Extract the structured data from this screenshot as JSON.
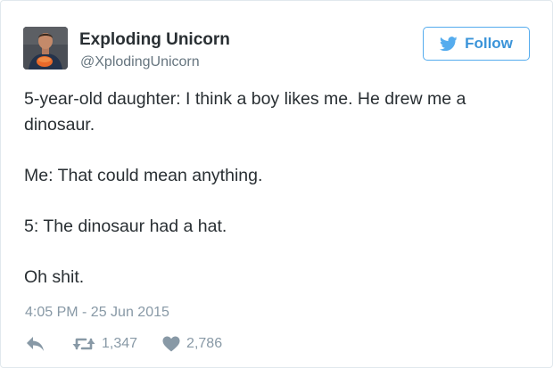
{
  "tweet": {
    "author": {
      "display_name": "Exploding Unicorn",
      "screen_name": "@XplodingUnicorn"
    },
    "follow_label": "Follow",
    "text_paragraphs": [
      "5-year-old daughter: I think a boy likes me. He drew me a dinosaur.",
      "Me: That could mean anything.",
      "5: The dinosaur had a hat.",
      "Oh shit."
    ],
    "timestamp": "4:05 PM - 25 Jun 2015",
    "retweet_count": "1,347",
    "like_count": "2,786"
  },
  "colors": {
    "text": "#292f33",
    "secondary": "#8899a6",
    "handle": "#66757f",
    "twitter_blue": "#55acee"
  },
  "icons": {
    "reply": "reply-icon",
    "retweet": "retweet-icon",
    "like": "heart-icon",
    "brand": "twitter-bird-icon"
  }
}
